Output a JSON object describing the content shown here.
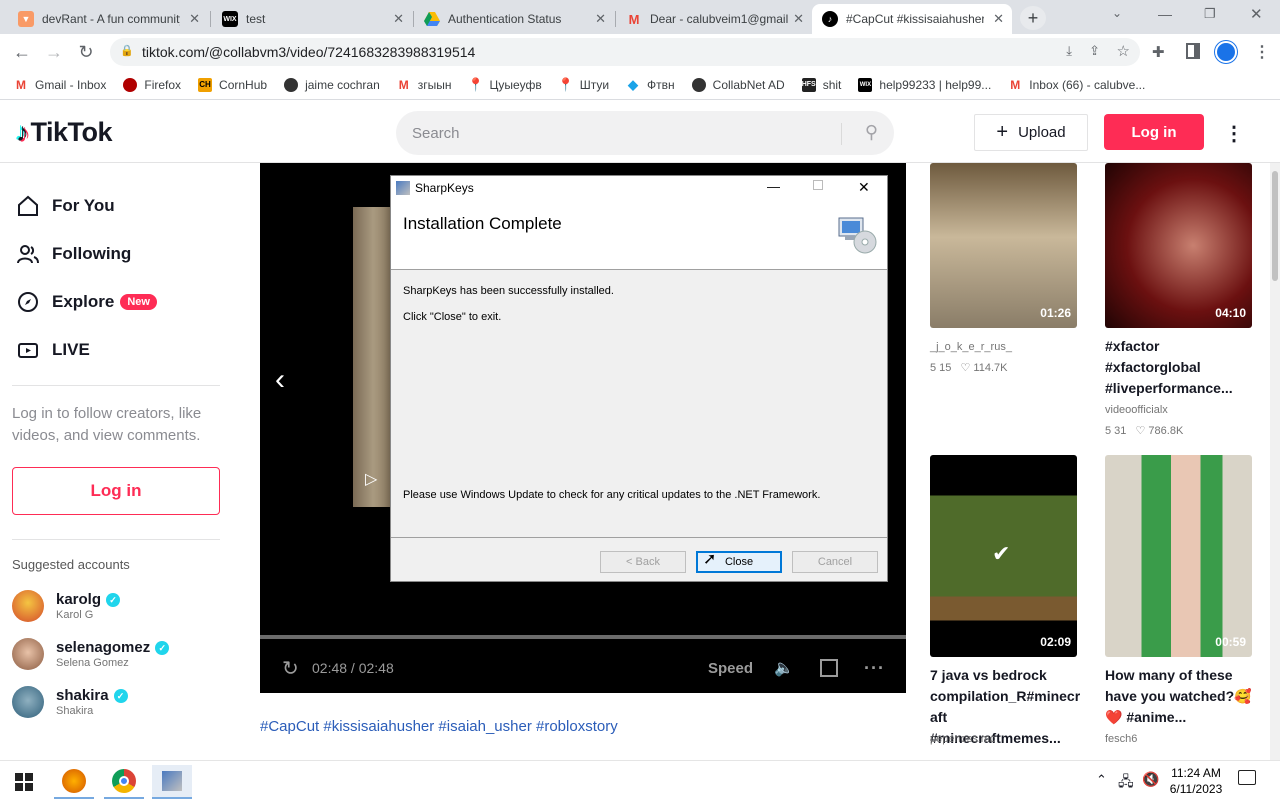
{
  "browser": {
    "tabs": [
      {
        "title": "devRant - A fun community",
        "icon": "devrant-icon",
        "color": "#f99a66"
      },
      {
        "title": "test",
        "icon": "wix-icon",
        "color": "#000000"
      },
      {
        "title": "Authentication Status",
        "icon": "google-drive-icon",
        "color": "#1fa463"
      },
      {
        "title": "Dear - calubveim1@gmail",
        "icon": "gmail-icon",
        "color": "#ea4335"
      },
      {
        "title": "#CapCut #kissisaiahusher",
        "icon": "tiktok-icon",
        "color": "#000000"
      }
    ],
    "url": "tiktok.com/@collabvm3/video/7241683283988319514",
    "bookmarks": [
      {
        "label": "Gmail - Inbox",
        "icon": "gmail-icon",
        "color": "#ea4335"
      },
      {
        "label": "Firefox",
        "icon": "firefox-icon",
        "color": "#b00000"
      },
      {
        "label": "CornHub",
        "icon": "cornhub-icon",
        "color": "#f0a000"
      },
      {
        "label": "jaime cochran",
        "icon": "globe-icon",
        "color": "#333333"
      },
      {
        "label": "згыын",
        "icon": "gmail-icon",
        "color": "#ea4335"
      },
      {
        "label": "Цуыеуфв",
        "icon": "maps-pin-icon",
        "color": "#34a853"
      },
      {
        "label": "Штуи",
        "icon": "maps-pin-icon",
        "color": "#34a853"
      },
      {
        "label": "Фтвн",
        "icon": "diamond-icon",
        "color": "#1aa3e8"
      },
      {
        "label": "CollabNet AD",
        "icon": "globe-icon",
        "color": "#333333"
      },
      {
        "label": "shit",
        "icon": "hfs-icon",
        "color": "#222222"
      },
      {
        "label": "help99233 | help99...",
        "icon": "wix-icon",
        "color": "#000000"
      },
      {
        "label": "Inbox (66) - calubve...",
        "icon": "gmail-icon",
        "color": "#ea4335"
      }
    ]
  },
  "tiktok": {
    "logo": "TikTok",
    "search_placeholder": "Search",
    "upload_label": "Upload",
    "login_label": "Log in",
    "nav": [
      {
        "label": "For You",
        "icon": "home-icon"
      },
      {
        "label": "Following",
        "icon": "users-icon"
      },
      {
        "label": "Explore",
        "icon": "compass-icon",
        "badge": "New"
      },
      {
        "label": "LIVE",
        "icon": "live-icon"
      }
    ],
    "login_prompt": "Log in to follow creators, like videos, and view comments.",
    "side_login_label": "Log in",
    "suggested_heading": "Suggested accounts",
    "accounts": [
      {
        "name": "karolg",
        "display": "Karol G",
        "color": "#d44a2a"
      },
      {
        "name": "selenagomez",
        "display": "Selena Gomez",
        "color": "#c59a7a"
      },
      {
        "name": "shakira",
        "display": "Shakira",
        "color": "#2f5f7a"
      }
    ],
    "player": {
      "time": "02:48 / 02:48",
      "speed_label": "Speed"
    },
    "hashtags": "#CapCut #kissisaiahusher #isaiah_usher #robloxstory",
    "videos": [
      {
        "author": "_j_o_k_e_r_rus_",
        "views": "5 15",
        "likes": "114.7K",
        "duration": "01:26",
        "title": "",
        "thumb_color": "#8a7d68"
      },
      {
        "author": "videoofficialx",
        "views": "5 31",
        "likes": "786.8K",
        "duration": "04:10",
        "title": "#xfactor #xfactorglobal #liveperformance...",
        "thumb_color": "#6b1010"
      },
      {
        "author": "pepenoss.mc",
        "views": "",
        "likes": "",
        "duration": "02:09",
        "title": "7 java vs bedrock compilation_R#minecr aft #minecraftmemes...",
        "thumb_color": "#4f6b2a"
      },
      {
        "author": "fesch6",
        "views": "",
        "likes": "",
        "duration": "00:59",
        "title": "How many of these have you watched?🥰 ❤️ #anime...",
        "thumb_color": "#3a9c4a"
      }
    ]
  },
  "dialog": {
    "window_title": "SharpKeys",
    "heading": "Installation Complete",
    "line1": "SharpKeys has been successfully installed.",
    "line2": "Click \"Close\" to exit.",
    "line3": "Please use Windows Update to check for any critical updates to the .NET Framework.",
    "back_label": "< Back",
    "close_label": "Close",
    "cancel_label": "Cancel"
  },
  "taskbar": {
    "time": "11:24 AM",
    "date": "6/11/2023"
  }
}
